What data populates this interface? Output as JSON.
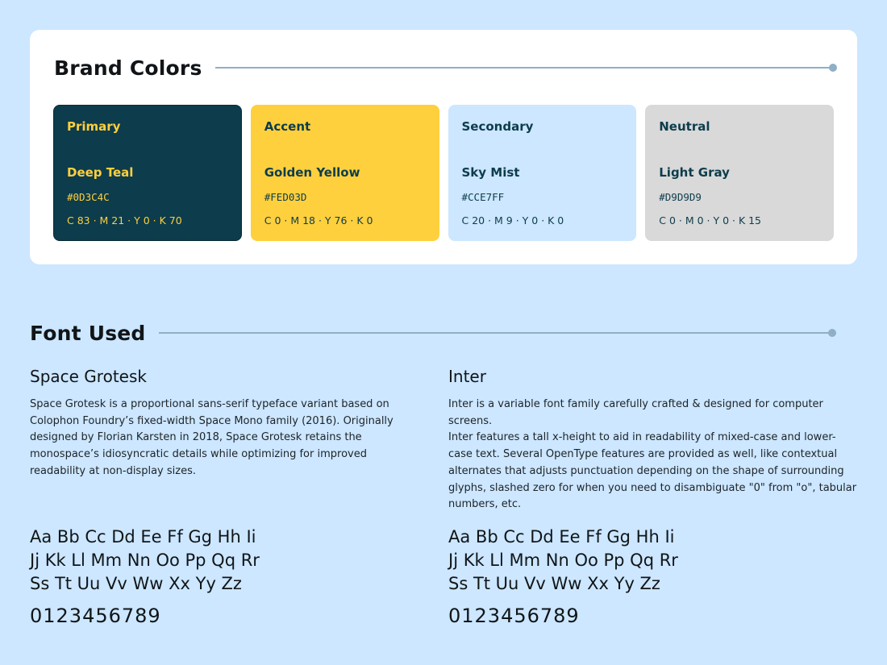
{
  "brand_colors": {
    "title": "Brand Colors",
    "swatches": [
      {
        "role": "Primary",
        "name": "Deep Teal",
        "hex": "#0D3C4C",
        "cmyk": "C 83 · M 21 · Y 0 · K 70",
        "bg": "#0D3C4C",
        "fg": "#FED03D",
        "border": "#0A2A36"
      },
      {
        "role": "Accent",
        "name": "Golden Yellow",
        "hex": "#FED03D",
        "cmyk": "C 0 · M 18 · Y 76 · K 0",
        "bg": "#FED03D",
        "fg": "#0D3C4C",
        "border": "#FED03D"
      },
      {
        "role": "Secondary",
        "name": "Sky Mist",
        "hex": "#CCE7FF",
        "cmyk": "C 20 · M 9 · Y 0 · K 0",
        "bg": "#CCE7FF",
        "fg": "#0D3C4C",
        "border": "#CCE7FF"
      },
      {
        "role": "Neutral",
        "name": "Light Gray",
        "hex": "#D9D9D9",
        "cmyk": "C 0 · M 0 · Y 0 · K 15",
        "bg": "#D9D9D9",
        "fg": "#0D3C4C",
        "border": "#D9D9D9"
      }
    ]
  },
  "fonts": {
    "title": "Font Used",
    "items": [
      {
        "name": "Space Grotesk",
        "description": "Space Grotesk is a proportional sans-serif typeface variant based on Colophon Foundry’s fixed-width Space Mono family (2016). Originally designed by Florian Karsten in 2018, Space Grotesk retains the monospace’s idiosyncratic details while optimizing for improved readability at non-display sizes.",
        "specimen": [
          "Aa Bb Cc Dd Ee Ff Gg Hh Ii",
          "Jj Kk Ll Mm Nn Oo Pp Qq Rr",
          "Ss Tt Uu Vv Ww Xx Yy Zz"
        ],
        "digits": "0123456789"
      },
      {
        "name": "Inter",
        "description": "Inter is a variable font family carefully crafted & designed for computer screens.\nInter features a tall x-height to aid in readability of mixed-case and lower-case text. Several OpenType features are provided as well, like contextual alternates that adjusts punctuation depending on the shape of surrounding glyphs, slashed zero for when you need to disambiguate \"0\" from \"o\", tabular numbers, etc.",
        "specimen": [
          "Aa Bb Cc Dd Ee Ff Gg Hh Ii",
          "Jj Kk Ll Mm Nn Oo Pp Qq Rr",
          "Ss Tt Uu Vv Ww Xx Yy Zz"
        ],
        "digits": "0123456789"
      }
    ]
  },
  "colors": {
    "page_bg": "#CCE7FF",
    "card_bg": "#FFFFFF",
    "rule": "#8FAFC6"
  }
}
